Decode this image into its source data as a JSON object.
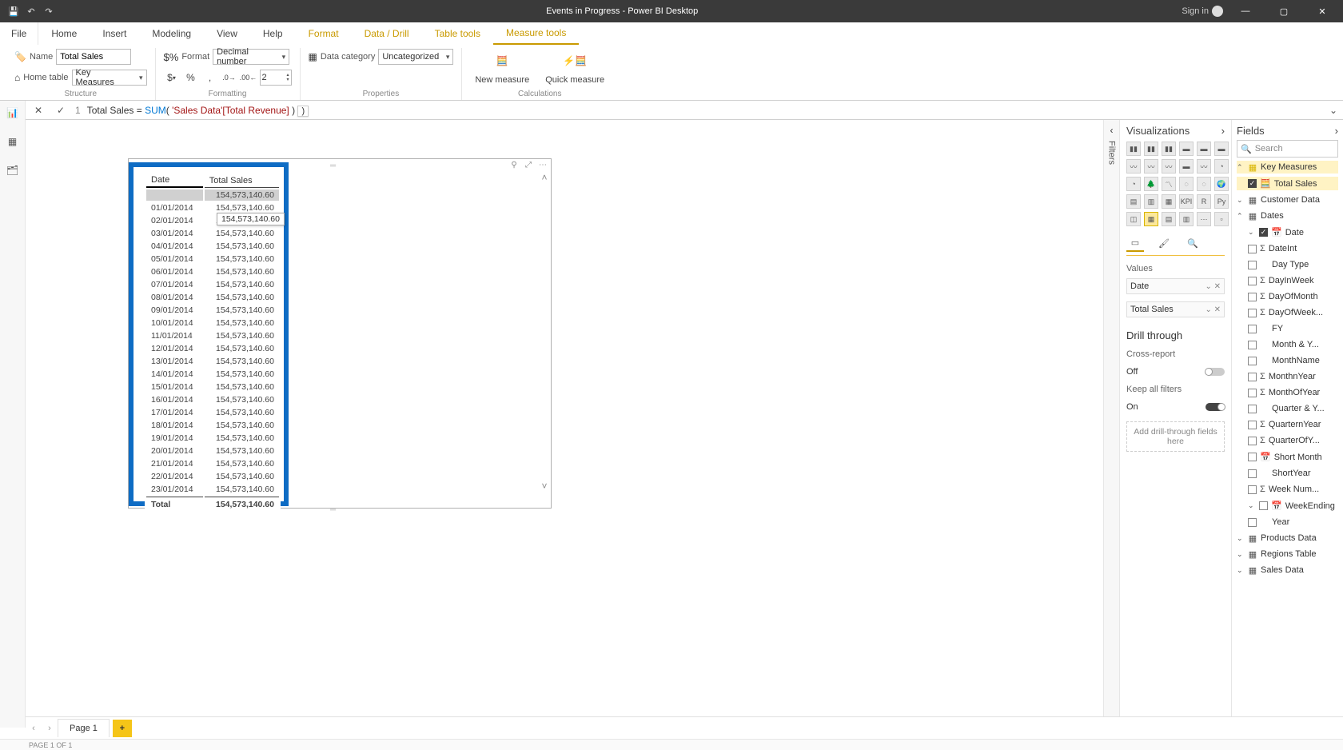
{
  "titlebar": {
    "title": "Events in Progress - Power BI Desktop",
    "signin": "Sign in"
  },
  "file_tab": "File",
  "tabs": [
    "Home",
    "Insert",
    "Modeling",
    "View",
    "Help",
    "Format",
    "Data / Drill",
    "Table tools",
    "Measure tools"
  ],
  "ribbon": {
    "name_label": "Name",
    "name_value": "Total Sales",
    "home_table_label": "Home table",
    "home_table_value": "Key Measures",
    "structure_label": "Structure",
    "format_label": "Format",
    "format_value": "Decimal number",
    "currency": "$",
    "pct": "%",
    "comma": ",",
    "dec_inc": ".0",
    "dec_dec": ".00",
    "decimals_value": "2",
    "formatting_label": "Formatting",
    "data_category_label": "Data category",
    "data_category_value": "Uncategorized",
    "properties_label": "Properties",
    "new_measure": "New measure",
    "quick_measure": "Quick measure",
    "calculations_label": "Calculations"
  },
  "formula": {
    "line": "1",
    "measure_name": "Total Sales",
    "eq": " = ",
    "func": "SUM",
    "open": "(",
    "arg": " 'Sales Data'[Total Revenue] ",
    "close": ")",
    "hint_close": ")"
  },
  "visual": {
    "headers": {
      "date": "Date",
      "total_sales": "Total Sales"
    },
    "blank_value": "154,573,140.60",
    "tooltip": "154,573,140.60",
    "rows": [
      {
        "d": "01/01/2014",
        "v": "154,573,140.60"
      },
      {
        "d": "02/01/2014",
        "v": "154,573,140.60"
      },
      {
        "d": "03/01/2014",
        "v": "154,573,140.60"
      },
      {
        "d": "04/01/2014",
        "v": "154,573,140.60"
      },
      {
        "d": "05/01/2014",
        "v": "154,573,140.60"
      },
      {
        "d": "06/01/2014",
        "v": "154,573,140.60"
      },
      {
        "d": "07/01/2014",
        "v": "154,573,140.60"
      },
      {
        "d": "08/01/2014",
        "v": "154,573,140.60"
      },
      {
        "d": "09/01/2014",
        "v": "154,573,140.60"
      },
      {
        "d": "10/01/2014",
        "v": "154,573,140.60"
      },
      {
        "d": "11/01/2014",
        "v": "154,573,140.60"
      },
      {
        "d": "12/01/2014",
        "v": "154,573,140.60"
      },
      {
        "d": "13/01/2014",
        "v": "154,573,140.60"
      },
      {
        "d": "14/01/2014",
        "v": "154,573,140.60"
      },
      {
        "d": "15/01/2014",
        "v": "154,573,140.60"
      },
      {
        "d": "16/01/2014",
        "v": "154,573,140.60"
      },
      {
        "d": "17/01/2014",
        "v": "154,573,140.60"
      },
      {
        "d": "18/01/2014",
        "v": "154,573,140.60"
      },
      {
        "d": "19/01/2014",
        "v": "154,573,140.60"
      },
      {
        "d": "20/01/2014",
        "v": "154,573,140.60"
      },
      {
        "d": "21/01/2014",
        "v": "154,573,140.60"
      },
      {
        "d": "22/01/2014",
        "v": "154,573,140.60"
      },
      {
        "d": "23/01/2014",
        "v": "154,573,140.60"
      }
    ],
    "total_label": "Total",
    "total_value": "154,573,140.60"
  },
  "filters_label": "Filters",
  "viz": {
    "title": "Visualizations",
    "values_label": "Values",
    "wells": [
      {
        "label": "Date"
      },
      {
        "label": "Total Sales"
      }
    ],
    "drill_title": "Drill through",
    "cross_report": "Cross-report",
    "off": "Off",
    "keep_all": "Keep all filters",
    "on": "On",
    "drop_hint": "Add drill-through fields here"
  },
  "fields": {
    "title": "Fields",
    "search_placeholder": "Search",
    "key_measures": "Key Measures",
    "total_sales": "Total Sales",
    "customer_data": "Customer Data",
    "dates": "Dates",
    "date": "Date",
    "dateint": "DateInt",
    "day_type": "Day Type",
    "day_in_week": "DayInWeek",
    "day_of_month": "DayOfMonth",
    "day_of_week": "DayOfWeek...",
    "fy": "FY",
    "month_y": "Month & Y...",
    "month_name": "MonthName",
    "monthn_year": "MonthnYear",
    "month_of_year": "MonthOfYear",
    "quarter_y": "Quarter & Y...",
    "quartern_year": "QuarternYear",
    "quarter_of_y": "QuarterOfY...",
    "short_month": "Short Month",
    "short_year": "ShortYear",
    "week_num": "Week Num...",
    "week_ending": "WeekEnding",
    "year": "Year",
    "products_data": "Products Data",
    "regions_table": "Regions Table",
    "sales_data": "Sales Data"
  },
  "page_tabs": {
    "page1": "Page 1",
    "add": "+"
  },
  "status": "PAGE 1 OF 1"
}
